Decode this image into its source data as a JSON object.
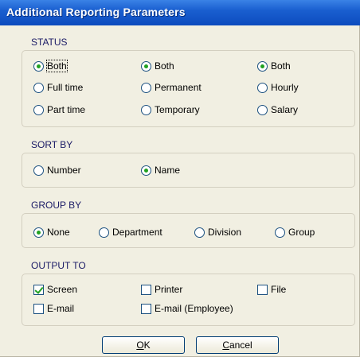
{
  "window": {
    "title": "Additional Reporting Parameters"
  },
  "status": {
    "label": "STATUS",
    "col1": [
      {
        "label": "Both",
        "selected": true
      },
      {
        "label": "Full time",
        "selected": false
      },
      {
        "label": "Part time",
        "selected": false
      }
    ],
    "col2": [
      {
        "label": "Both",
        "selected": true
      },
      {
        "label": "Permanent",
        "selected": false
      },
      {
        "label": "Temporary",
        "selected": false
      }
    ],
    "col3": [
      {
        "label": "Both",
        "selected": true
      },
      {
        "label": "Hourly",
        "selected": false
      },
      {
        "label": "Salary",
        "selected": false
      }
    ]
  },
  "sort_by": {
    "label": "SORT BY",
    "options": [
      {
        "label": "Number",
        "selected": false
      },
      {
        "label": "Name",
        "selected": true
      }
    ]
  },
  "group_by": {
    "label": "GROUP BY",
    "options": [
      {
        "label": "None",
        "selected": true
      },
      {
        "label": "Department",
        "selected": false
      },
      {
        "label": "Division",
        "selected": false
      },
      {
        "label": "Group",
        "selected": false
      }
    ]
  },
  "output_to": {
    "label": "OUTPUT TO",
    "options": [
      {
        "label": "Screen",
        "checked": true
      },
      {
        "label": "Printer",
        "checked": false
      },
      {
        "label": "File",
        "checked": false
      },
      {
        "label": "E-mail",
        "checked": false
      },
      {
        "label": "E-mail (Employee)",
        "checked": false
      }
    ]
  },
  "buttons": {
    "ok": {
      "mnemonic": "O",
      "rest": "K"
    },
    "cancel": {
      "mnemonic": "C",
      "rest": "ancel"
    }
  },
  "colors": {
    "titlebar": "#0c4bbe",
    "check_mark": "#21a121",
    "group_label": "#1b1b66"
  }
}
